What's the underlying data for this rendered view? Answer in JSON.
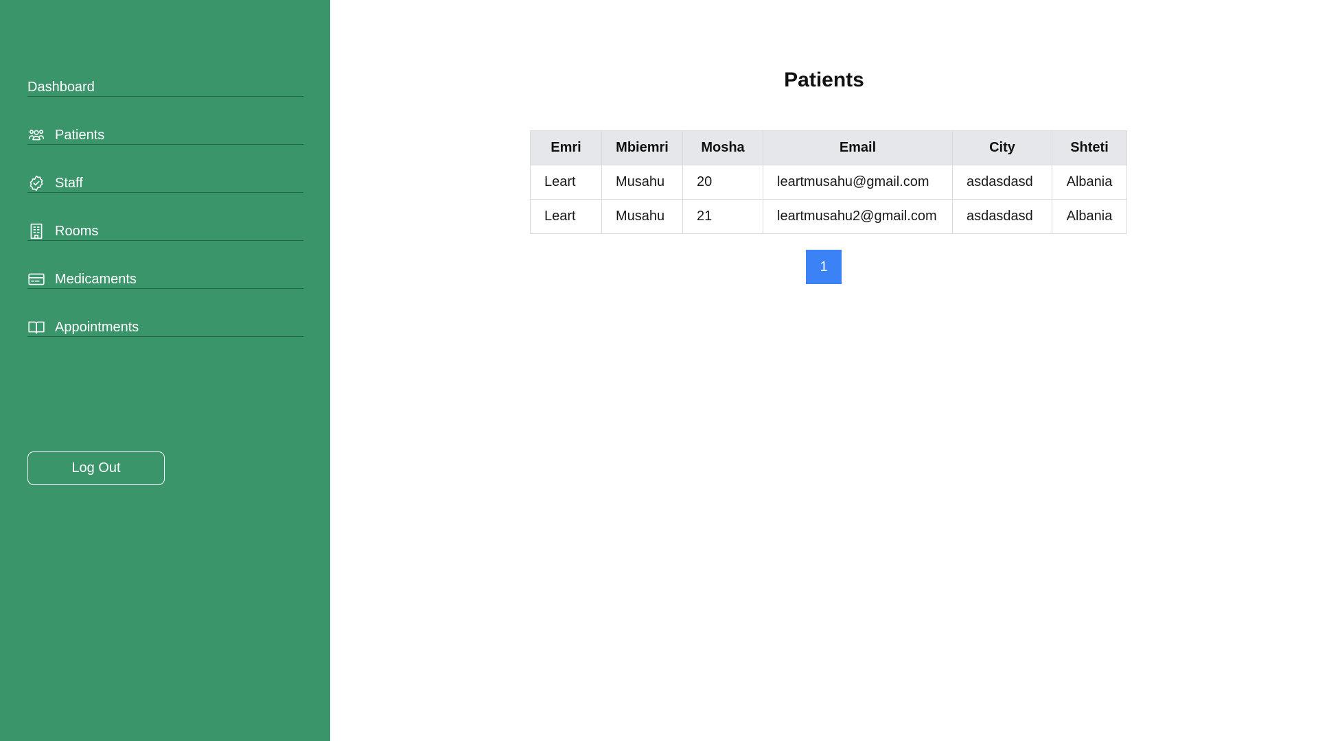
{
  "sidebar": {
    "background": "#3a956b",
    "items": [
      {
        "label": "Dashboard",
        "icon": ""
      },
      {
        "label": "Patients",
        "icon": "users-icon"
      },
      {
        "label": "Staff",
        "icon": "badge-check-icon"
      },
      {
        "label": "Rooms",
        "icon": "building-icon"
      },
      {
        "label": "Medicaments",
        "icon": "card-icon"
      },
      {
        "label": "Appointments",
        "icon": "book-icon"
      }
    ],
    "logout_label": "Log Out"
  },
  "main": {
    "title": "Patients",
    "table": {
      "headers": [
        "Emri",
        "Mbiemri",
        "Mosha",
        "Email",
        "City",
        "Shteti"
      ],
      "rows": [
        [
          "Leart",
          "Musahu",
          "20",
          "leartmusahu@gmail.com",
          "asdasdasd",
          "Albania"
        ],
        [
          "Leart",
          "Musahu",
          "21",
          "leartmusahu2@gmail.com",
          "asdasdasd",
          "Albania"
        ]
      ]
    },
    "pagination": {
      "current_page": "1",
      "accent": "#3b82f6"
    }
  }
}
